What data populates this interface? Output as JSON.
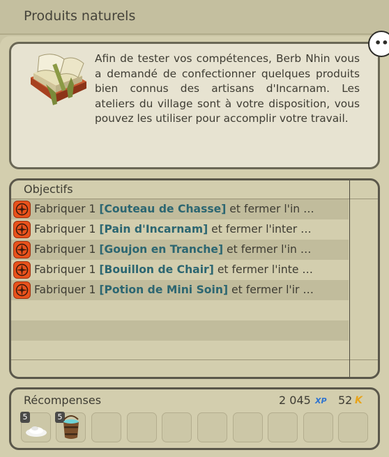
{
  "window": {
    "title": "Produits naturels"
  },
  "description": {
    "text": "Afin de tester vos compétences, Berb Nhin vous a demandé de confectionner quelques produits bien connus des artisans d'Incarnam. Les ateliers du village sont à votre disposition, vous pouvez les utiliser pour accomplir votre travail."
  },
  "objectives": {
    "header": "Objectifs",
    "items": [
      {
        "prefix": "Fabriquer 1 ",
        "item": "[Couteau de Chasse]",
        "suffix": " et fermer l'in …"
      },
      {
        "prefix": "Fabriquer 1 ",
        "item": "[Pain d'Incarnam]",
        "suffix": " et fermer l'inter …"
      },
      {
        "prefix": "Fabriquer 1 ",
        "item": "[Goujon en Tranche]",
        "suffix": " et fermer l'in …"
      },
      {
        "prefix": "Fabriquer 1 ",
        "item": "[Bouillon de Chair]",
        "suffix": " et fermer l'inte …"
      },
      {
        "prefix": "Fabriquer 1 ",
        "item": "[Potion de Mini Soin]",
        "suffix": " et fermer l'ir …"
      }
    ]
  },
  "rewards": {
    "header": "Récompenses",
    "xp": "2 045",
    "xp_label": "XP",
    "kamas": "52",
    "kamas_label": "K",
    "slots": [
      {
        "qty": "5",
        "icon": "salt-powder-icon"
      },
      {
        "qty": "5",
        "icon": "water-bucket-icon"
      }
    ]
  },
  "colors": {
    "background": "#d3ceae",
    "item_link": "#2c6671",
    "objective_icon": "#e8521c",
    "xp": "#2f74d0",
    "kamas": "#e8a41a"
  }
}
